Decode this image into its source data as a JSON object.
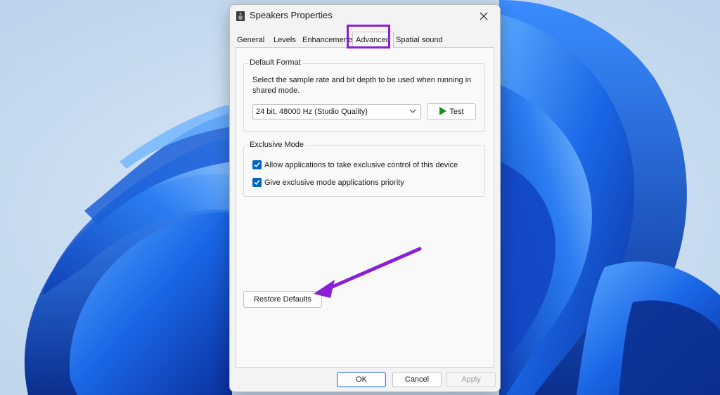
{
  "dialog": {
    "title": "Speakers Properties",
    "tabs": [
      {
        "label": "General"
      },
      {
        "label": "Levels"
      },
      {
        "label": "Enhancements"
      },
      {
        "label": "Advanced"
      },
      {
        "label": "Spatial sound"
      }
    ],
    "active_tab": "Advanced",
    "default_format": {
      "legend": "Default Format",
      "description": "Select the sample rate and bit depth to be used when running in shared mode.",
      "selected_format": "24 bit, 48000 Hz (Studio Quality)",
      "test_label": "Test"
    },
    "exclusive_mode": {
      "legend": "Exclusive Mode",
      "options": [
        {
          "label": "Allow applications to take exclusive control of this device",
          "checked": true
        },
        {
          "label": "Give exclusive mode applications priority",
          "checked": true
        }
      ]
    },
    "restore_defaults_label": "Restore Defaults",
    "buttons": {
      "ok": "OK",
      "cancel": "Cancel",
      "apply": "Apply"
    }
  },
  "annotations": {
    "highlight_color": "#8a1fd6",
    "arrow_color": "#8a1fd6"
  },
  "colors": {
    "checkbox": "#0067c0",
    "test_play_icon": "#1e8c1e"
  }
}
